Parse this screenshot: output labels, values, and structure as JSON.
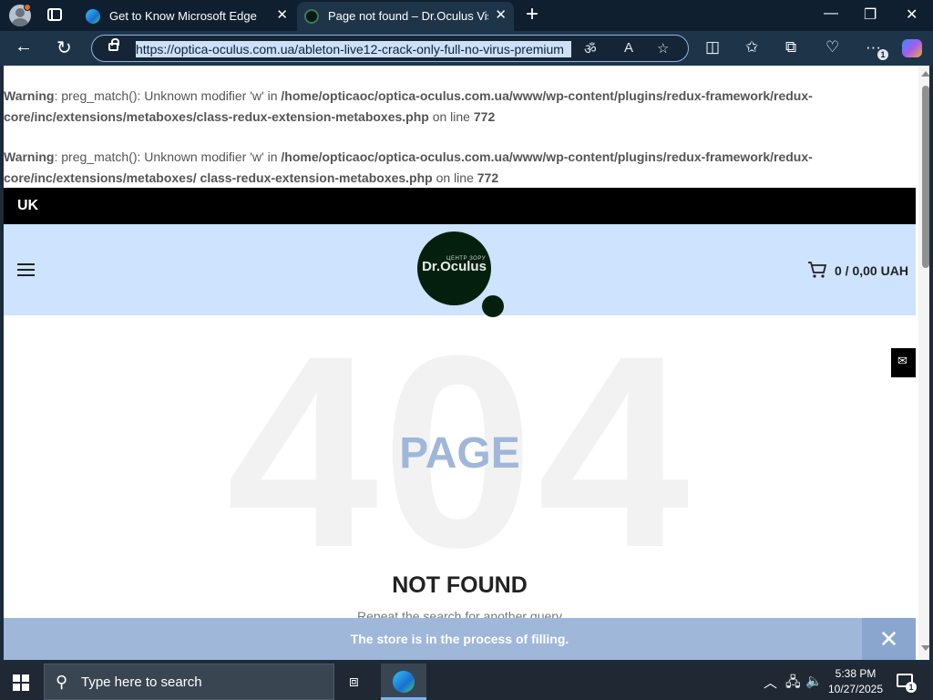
{
  "browser": {
    "tabs": [
      {
        "title": "Get to Know Microsoft Edge",
        "close": "✕"
      },
      {
        "title": "Page not found – Dr.Oculus Vision",
        "close": "✕"
      }
    ],
    "new_tab": "+",
    "window_controls": {
      "minimize": "—",
      "maximize": "❐",
      "close": "✕"
    },
    "url": "https://optica-oculus.com.ua/ableton-live12-crack-only-full-no-virus-premium",
    "back": "←",
    "refresh": "↻",
    "omni_icons": {
      "translate": "ॐ",
      "read_aloud": "A",
      "favorite": "☆"
    },
    "toolbar_icons": {
      "split": "◫",
      "favorites": "✩",
      "collections": "⧉",
      "performance": "♡",
      "more": "···"
    },
    "extension_badge": "1"
  },
  "page": {
    "warnings": [
      {
        "label": "Warning",
        "message": ": preg_match(): Unknown modifier 'w' in ",
        "path": "/home/opticaoc/optica-oculus.com.ua/www/wp-content/plugins/redux-framework/redux-core/inc/extensions/metaboxes/class-redux-extension-metaboxes.php",
        "on_line": " on line ",
        "line": "772"
      },
      {
        "label": "Warning",
        "message": ": preg_match(): Unknown modifier 'w' in ",
        "path": "/home/opticaoc/optica-oculus.com.ua/www/wp-content/plugins/redux-framework/redux-core/inc/extensions/metaboxes/ class-redux-extension-metaboxes.php",
        "on_line": " on line ",
        "line": "772"
      }
    ],
    "language": "UK",
    "logo": {
      "small": "ЦЕНТР ЗОРУ",
      "text": "Dr.Oculus"
    },
    "cart_total": "0 / 0,00 UAH",
    "error_code": "404",
    "page_word": "PAGE",
    "not_found": "NOT FOUND",
    "repeat_text": "Repeat the search for another query",
    "notice": {
      "text": "The store is in the process of filling.",
      "close": "✕"
    },
    "mail_icon": "✉"
  },
  "taskbar": {
    "search_placeholder": "Type here to search",
    "search_icon": "⚲",
    "taskview_icon": "⧈",
    "tray": {
      "chevron": "︿",
      "network": "🖧",
      "volume": "🔈"
    },
    "time": "5:38 PM",
    "date": "10/27/2025",
    "notification_badge": "1"
  },
  "colors": {
    "header_bg": "#cde3fe",
    "notice_bg": "#9fb7d9",
    "logo_bg": "#051f0f",
    "topbar_bg": "#000000"
  }
}
